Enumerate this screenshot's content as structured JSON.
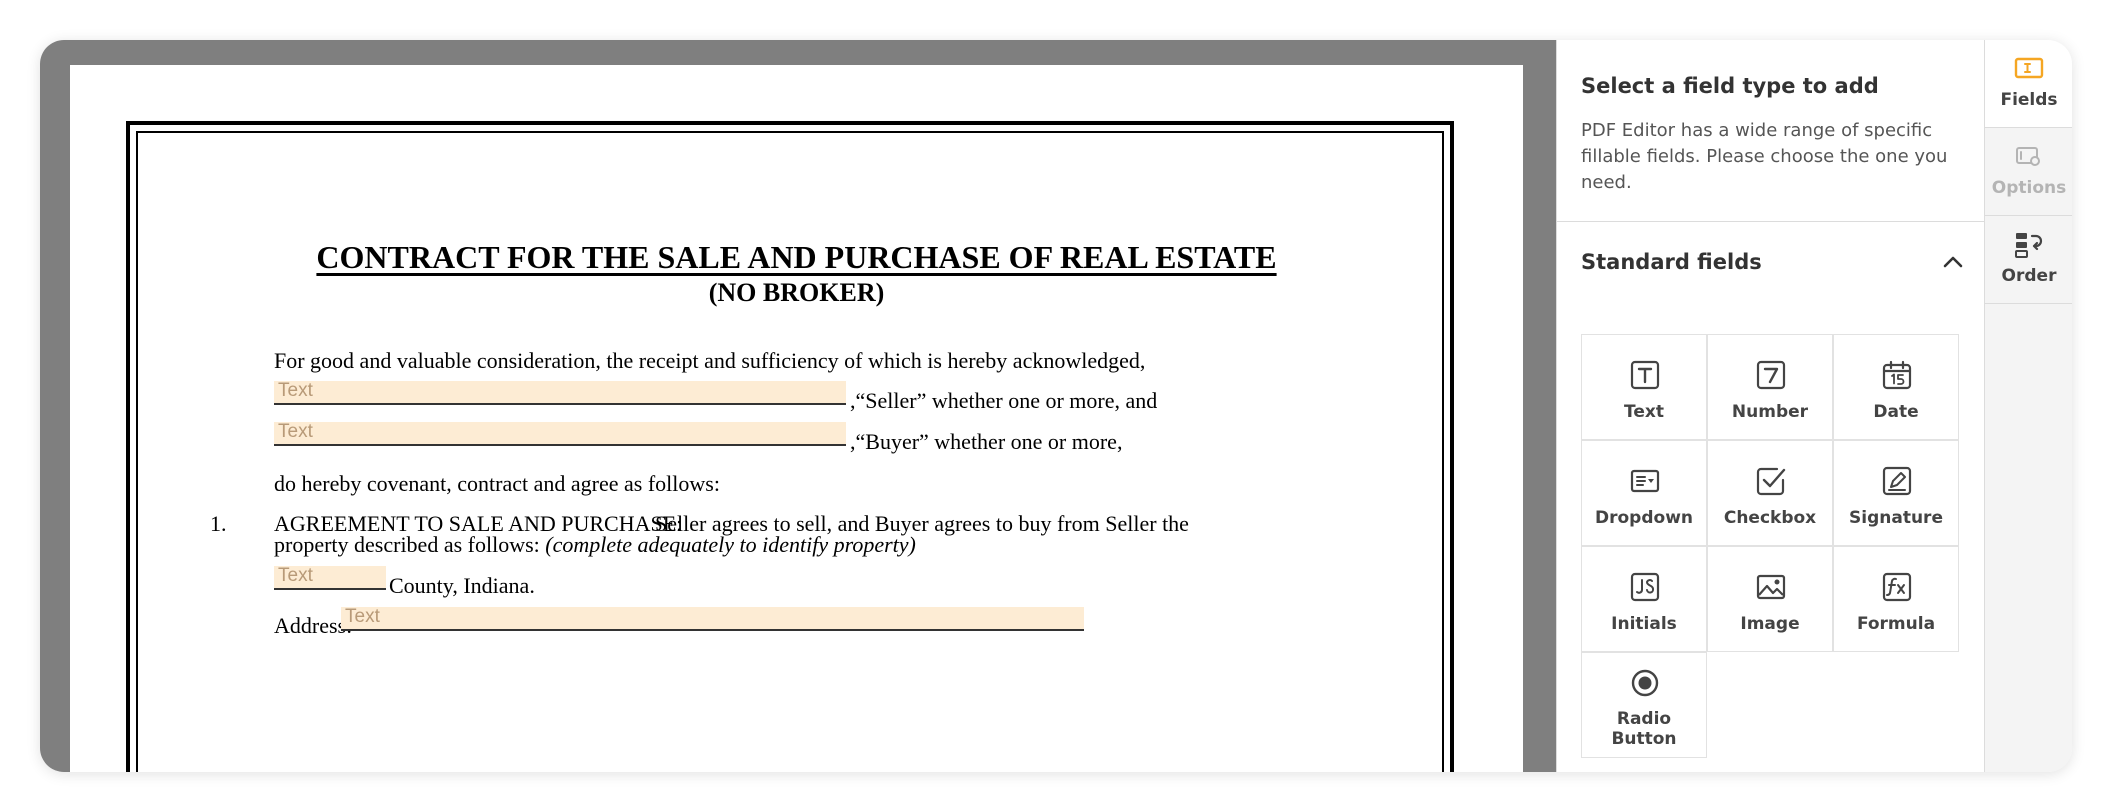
{
  "document": {
    "title": "CONTRACT FOR THE SALE AND PURCHASE OF REAL ESTATE",
    "subtitle": "(NO BROKER)",
    "intro": "For good and valuable consideration, the receipt and sufficiency of which is hereby acknowledged,",
    "seller_suffix": ",“Seller” whether one or more, and",
    "buyer_suffix": ",“Buyer” whether one or more,",
    "covenant": "do hereby covenant, contract and agree as follows:",
    "section1_number": "1.",
    "section1_heading": "AGREEMENT TO SALE AND PURCHASE:",
    "section1_text": "Seller agrees to sell, and Buyer agrees to  buy from Seller the",
    "section1_line2": "property described as follows:",
    "section1_italic": "(complete adequately to identify property)",
    "county_suffix": "County, Indiana.",
    "address_label": "Address:",
    "field_placeholder": "Text"
  },
  "panel": {
    "title": "Select a field type to add",
    "description": "PDF Editor has a wide range of specific fillable fields. Please choose the one you need.",
    "section_title": "Standard fields",
    "fields": [
      {
        "label": "Text",
        "icon": "text-field-icon"
      },
      {
        "label": "Number",
        "icon": "number-field-icon"
      },
      {
        "label": "Date",
        "icon": "date-field-icon"
      },
      {
        "label": "Dropdown",
        "icon": "dropdown-field-icon"
      },
      {
        "label": "Checkbox",
        "icon": "checkbox-field-icon"
      },
      {
        "label": "Signature",
        "icon": "signature-field-icon"
      },
      {
        "label": "Initials",
        "icon": "initials-field-icon"
      },
      {
        "label": "Image",
        "icon": "image-field-icon"
      },
      {
        "label": "Formula",
        "icon": "formula-field-icon"
      },
      {
        "label": "Radio\nButton",
        "icon": "radio-button-field-icon"
      }
    ]
  },
  "tabs": [
    {
      "label": "Fields",
      "state": "active",
      "icon": "fields-tab-icon"
    },
    {
      "label": "Options",
      "state": "disabled",
      "icon": "options-tab-icon"
    },
    {
      "label": "Order",
      "state": "normal",
      "icon": "order-tab-icon"
    }
  ],
  "colors": {
    "accent": "#f5a623",
    "field_highlight": "#fdecd4",
    "viewer_background": "#7f7f7f"
  }
}
